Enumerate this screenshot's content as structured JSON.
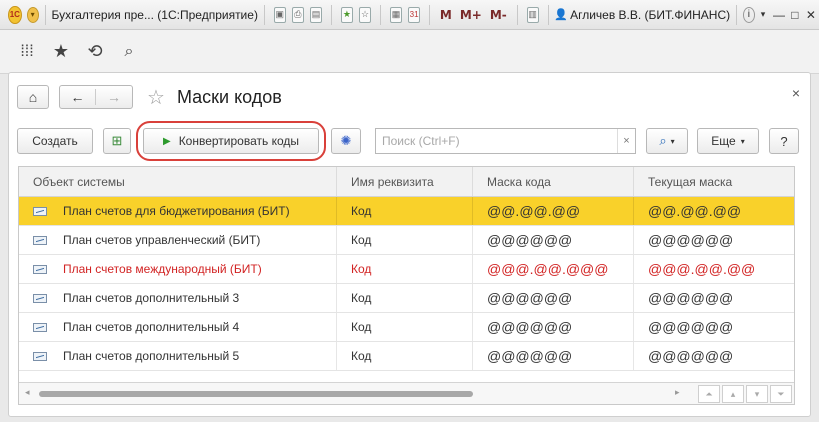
{
  "window": {
    "title": "Бухгалтерия пре... (1С:Предприятие)",
    "user": "Агличев В.В. (БИТ.ФИНАНС)",
    "m_buttons": [
      "M",
      "M+",
      "M-"
    ]
  },
  "form": {
    "title": "Маски кодов",
    "close": "×"
  },
  "toolbar": {
    "create": "Создать",
    "convert": "Конвертировать коды",
    "search_placeholder": "Поиск (Ctrl+F)",
    "search_clear": "×",
    "more": "Еще",
    "help": "?"
  },
  "table": {
    "columns": [
      "Объект системы",
      "Имя реквизита",
      "Маска кода",
      "Текущая маска"
    ],
    "rows": [
      {
        "object": "План счетов для бюджетирования (БИТ)",
        "attr": "Код",
        "mask": "@@.@@.@@",
        "current": "@@.@@.@@",
        "selected": true,
        "red": false
      },
      {
        "object": "План счетов управленческий (БИТ)",
        "attr": "Код",
        "mask": "@@@@@@",
        "current": "@@@@@@",
        "selected": false,
        "red": false
      },
      {
        "object": "План счетов международный (БИТ)",
        "attr": "Код",
        "mask": "@@@.@@.@@@",
        "current": "@@@.@@.@@",
        "selected": false,
        "red": true
      },
      {
        "object": "План счетов дополнительный 3",
        "attr": "Код",
        "mask": "@@@@@@",
        "current": "@@@@@@",
        "selected": false,
        "red": false
      },
      {
        "object": "План счетов дополнительный 4",
        "attr": "Код",
        "mask": "@@@@@@",
        "current": "@@@@@@",
        "selected": false,
        "red": false
      },
      {
        "object": "План счетов дополнительный 5",
        "attr": "Код",
        "mask": "@@@@@@",
        "current": "@@@@@@",
        "selected": false,
        "red": false
      }
    ]
  },
  "colors": {
    "selected_row": "#f9d12a",
    "red_text": "#d22323",
    "highlight_border": "#d9403a",
    "play_arrow": "#2c9a2c"
  }
}
